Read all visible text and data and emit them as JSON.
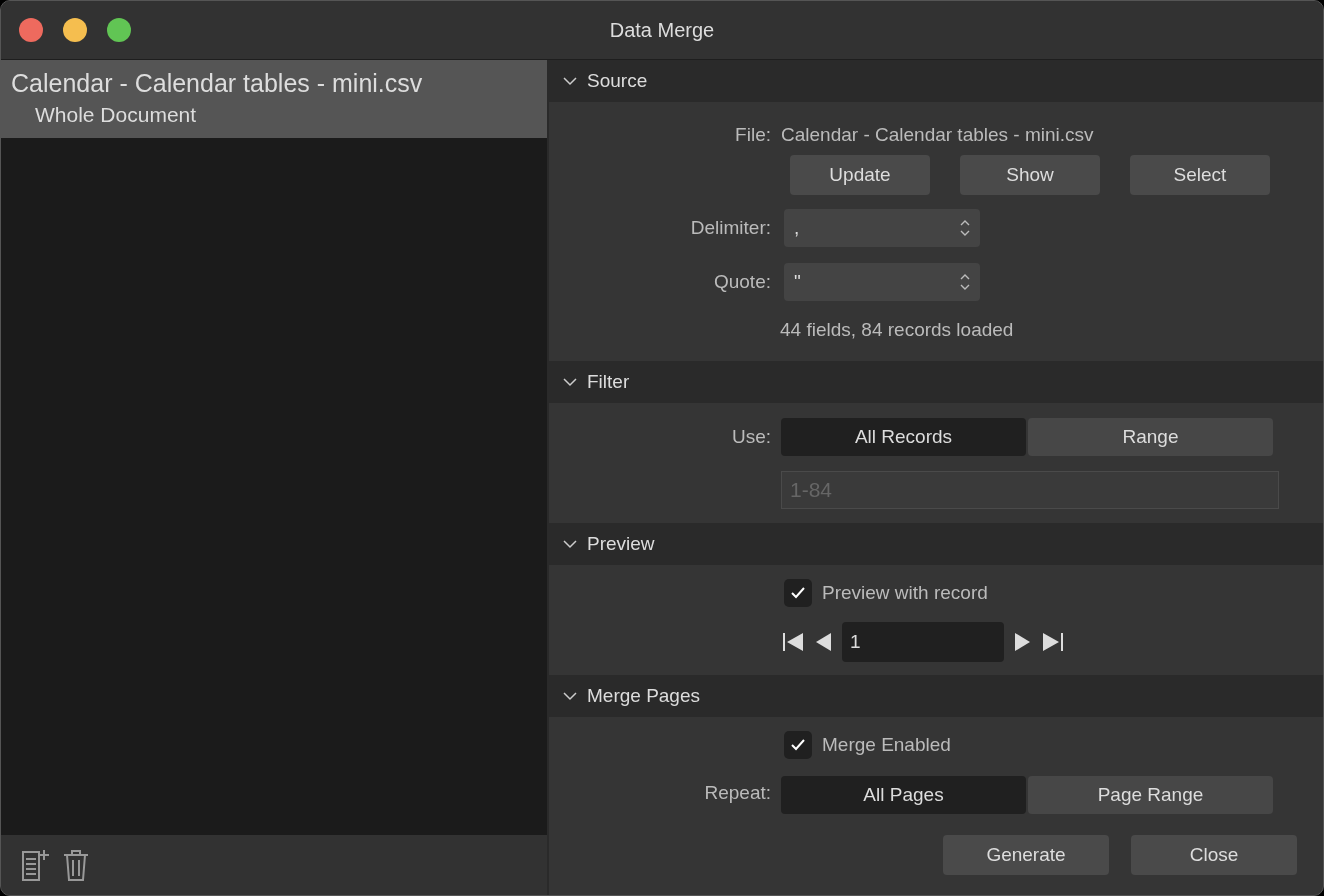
{
  "window": {
    "title": "Data Merge"
  },
  "sidebar": {
    "items": [
      {
        "label": "Calendar - Calendar tables - mini.csv",
        "selected": true,
        "children": [
          {
            "label": "Whole Document"
          }
        ]
      }
    ]
  },
  "source": {
    "title": "Source",
    "expanded": true,
    "file_label": "File:",
    "file_name": "Calendar - Calendar tables - mini.csv",
    "buttons": [
      "Update",
      "Show",
      "Select"
    ],
    "fields": [
      {
        "label": "Delimiter:",
        "value": ","
      },
      {
        "label": "Quote:",
        "value": "\""
      }
    ],
    "status": "44 fields, 84 records loaded"
  },
  "filter": {
    "title": "Filter",
    "expanded": true,
    "use_label": "Use:",
    "options": [
      {
        "label": "All Records",
        "selected": true
      },
      {
        "label": "Range",
        "selected": false
      }
    ],
    "range_field": {
      "value": "1-84",
      "disabled": true
    }
  },
  "preview": {
    "title": "Preview",
    "expanded": true,
    "checkbox": {
      "label": "Preview with record",
      "checked": true
    },
    "record": "1"
  },
  "merge_pages": {
    "title": "Merge Pages",
    "expanded": true,
    "checkbox": {
      "label": "Merge Enabled",
      "checked": true
    },
    "repeat_label": "Repeat:",
    "options": [
      {
        "label": "All Pages",
        "selected": true
      },
      {
        "label": "Page Range",
        "selected": false
      }
    ]
  },
  "footer_buttons": [
    "Generate",
    "Close"
  ]
}
